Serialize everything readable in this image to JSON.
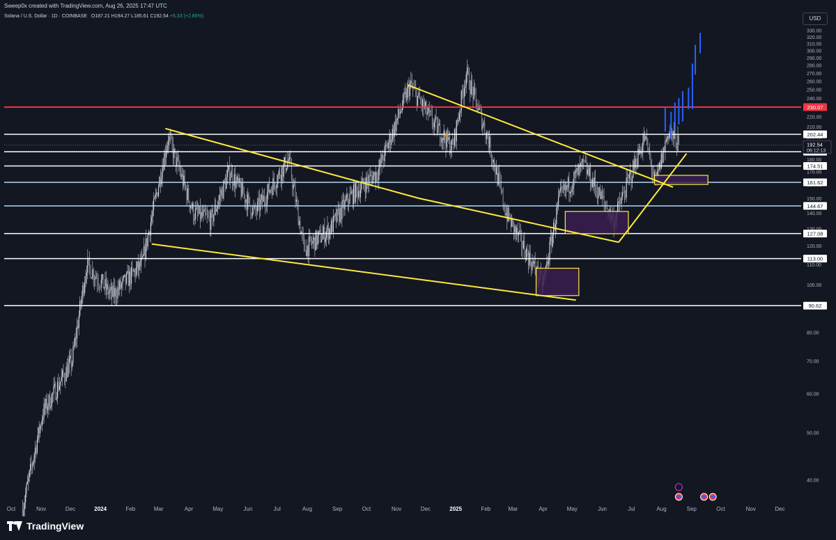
{
  "header": {
    "created_by": "Sweep0x created with TradingView.com, Aug 26, 2025 17:47 UTC"
  },
  "symbol_bar": {
    "name": "Solana / U.S. Dollar · 1D · COINBASE",
    "open_label": "O",
    "open": "187.21",
    "high_label": "H",
    "high": "194.27",
    "low_label": "L",
    "low": "185.61",
    "close_label": "C",
    "close": "192.54",
    "change": "+5.33 (+2.85%)"
  },
  "currency": "USD",
  "brand": {
    "name": "TradingView"
  },
  "colors": {
    "background": "#131722",
    "candles": "#b2b5be",
    "trendlines": "#ffeb3b",
    "resistance": "#f23645",
    "projection": "#2962ff",
    "boxes": "#ffeb3b",
    "box_fill": "#3a1f4f"
  },
  "icons": [
    "tradingview-logo-icon",
    "event-flag-icon"
  ],
  "chart_data": {
    "type": "candlestick",
    "y_scale": "log",
    "ylim": [
      36,
      338
    ],
    "y_ticks": [
      "330.00",
      "320.00",
      "310.00",
      "300.00",
      "290.00",
      "280.00",
      "270.00",
      "260.00",
      "250.00",
      "240.00",
      "230.00",
      "220.00",
      "210.00",
      "200.00",
      "190.00",
      "180.00",
      "170.00",
      "160.00",
      "150.00",
      "140.00",
      "130.00",
      "120.00",
      "110.00",
      "100.00",
      "90.00",
      "80.00",
      "70.00",
      "60.00",
      "50.00",
      "40.00"
    ],
    "x_ticks": [
      "Oct",
      "Nov",
      "Dec",
      "2024",
      "Feb",
      "Mar",
      "Apr",
      "May",
      "Jun",
      "Jul",
      "Aug",
      "Sep",
      "Oct",
      "Nov",
      "Dec",
      "2025",
      "Feb",
      "Mar",
      "Apr",
      "May",
      "Jun",
      "Jul",
      "Aug",
      "Sep",
      "Oct",
      "Nov",
      "Dec"
    ],
    "close_path": [
      [
        "2023-10-20",
        35
      ],
      [
        "2023-11-10",
        55
      ],
      [
        "2023-12-10",
        70
      ],
      [
        "2023-12-25",
        110
      ],
      [
        "2024-01-20",
        95
      ],
      [
        "2024-02-20",
        110
      ],
      [
        "2024-03-18",
        200
      ],
      [
        "2024-04-13",
        140
      ],
      [
        "2024-05-01",
        135
      ],
      [
        "2024-05-20",
        170
      ],
      [
        "2024-06-15",
        140
      ],
      [
        "2024-07-20",
        180
      ],
      [
        "2024-08-05",
        118
      ],
      [
        "2024-09-01",
        130
      ],
      [
        "2024-09-20",
        150
      ],
      [
        "2024-10-20",
        170
      ],
      [
        "2024-11-22",
        255
      ],
      [
        "2024-12-15",
        215
      ],
      [
        "2025-01-05",
        190
      ],
      [
        "2025-01-19",
        270
      ],
      [
        "2025-02-10",
        200
      ],
      [
        "2025-03-01",
        140
      ],
      [
        "2025-04-08",
        100
      ],
      [
        "2025-04-25",
        150
      ],
      [
        "2025-05-20",
        175
      ],
      [
        "2025-06-20",
        135
      ],
      [
        "2025-07-22",
        200
      ],
      [
        "2025-08-02",
        160
      ],
      [
        "2025-08-15",
        205
      ],
      [
        "2025-08-26",
        192.54
      ]
    ],
    "horizontal_levels": [
      {
        "value": 230.07,
        "label": "230.07",
        "color": "red"
      },
      {
        "value": 202.44,
        "label": "202.44",
        "color": "white"
      },
      {
        "value": 186.58,
        "label": "186.58",
        "color": "white"
      },
      {
        "value": 174.51,
        "label": "174.51",
        "color": "white"
      },
      {
        "value": 161.62,
        "label": "161.62",
        "color": "lightblue"
      },
      {
        "value": 144.67,
        "label": "144.67",
        "color": "lightblue"
      },
      {
        "value": 127.08,
        "label": "127.08",
        "color": "white"
      },
      {
        "value": 113.0,
        "label": "113.00",
        "color": "white"
      },
      {
        "value": 90.62,
        "label": "90.62",
        "color": "white"
      }
    ],
    "current_price": {
      "value": 192.54,
      "label": "192.54",
      "countdown": "06:12:13"
    },
    "trendlines": [
      {
        "from": [
          "2024-03-15",
          208
        ],
        "to": [
          "2024-12-01",
          150
        ]
      },
      {
        "from": [
          "2024-12-01",
          150
        ],
        "to": [
          "2025-06-25",
          122
        ]
      },
      {
        "from": [
          "2024-03-01",
          121
        ],
        "to": [
          "2025-05-12",
          93
        ]
      },
      {
        "from": [
          "2024-11-20",
          255
        ],
        "to": [
          "2025-08-20",
          158
        ]
      },
      {
        "from": [
          "2025-06-25",
          122
        ],
        "to": [
          "2025-09-03",
          185
        ]
      }
    ],
    "zones": [
      {
        "from": [
          "2025-04-01",
          108
        ],
        "to": [
          "2025-05-15",
          95
        ]
      },
      {
        "from": [
          "2025-05-01",
          141
        ],
        "to": [
          "2025-07-05",
          127
        ]
      },
      {
        "from": [
          "2025-08-01",
          167
        ],
        "to": [
          "2025-09-25",
          160
        ]
      }
    ],
    "projection_bars": [
      [
        "2025-08-12",
        205,
        230
      ],
      [
        "2025-08-18",
        198,
        225
      ],
      [
        "2025-08-22",
        205,
        235
      ],
      [
        "2025-08-26",
        212,
        240
      ],
      [
        "2025-08-30",
        215,
        248
      ],
      [
        "2025-09-05",
        228,
        252
      ],
      [
        "2025-09-09",
        228,
        282
      ],
      [
        "2025-09-12",
        268,
        308
      ],
      [
        "2025-09-17",
        296,
        326
      ]
    ]
  }
}
